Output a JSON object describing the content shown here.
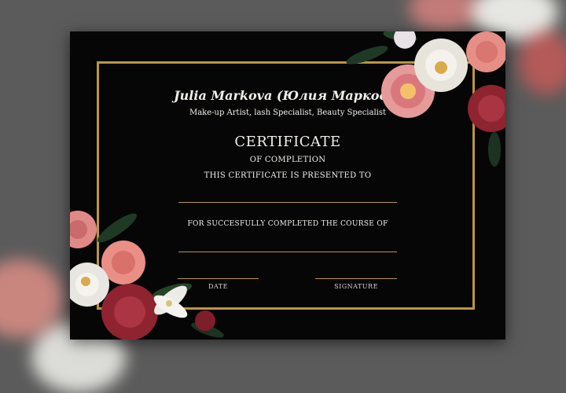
{
  "certificate": {
    "name": "Julia Markova (Юлия Маркова)",
    "profession": "Make-up Artist, lash Specialist, Beauty Specialist",
    "title": "CERTIFICATE",
    "subtitle": "OF COMPLETION",
    "presented_to": "THIS CERTIFICATE IS PRESENTED TO",
    "course_text": "FOR SUCCESFULLY COMPLETED THE COURSE OF",
    "date_label": "DATE",
    "signature_label": "SIGNATURE"
  },
  "colors": {
    "background": "#070607",
    "frame_gold": "#b9973f",
    "text": "#f2efe9",
    "backdrop": "#5b5b5b"
  }
}
